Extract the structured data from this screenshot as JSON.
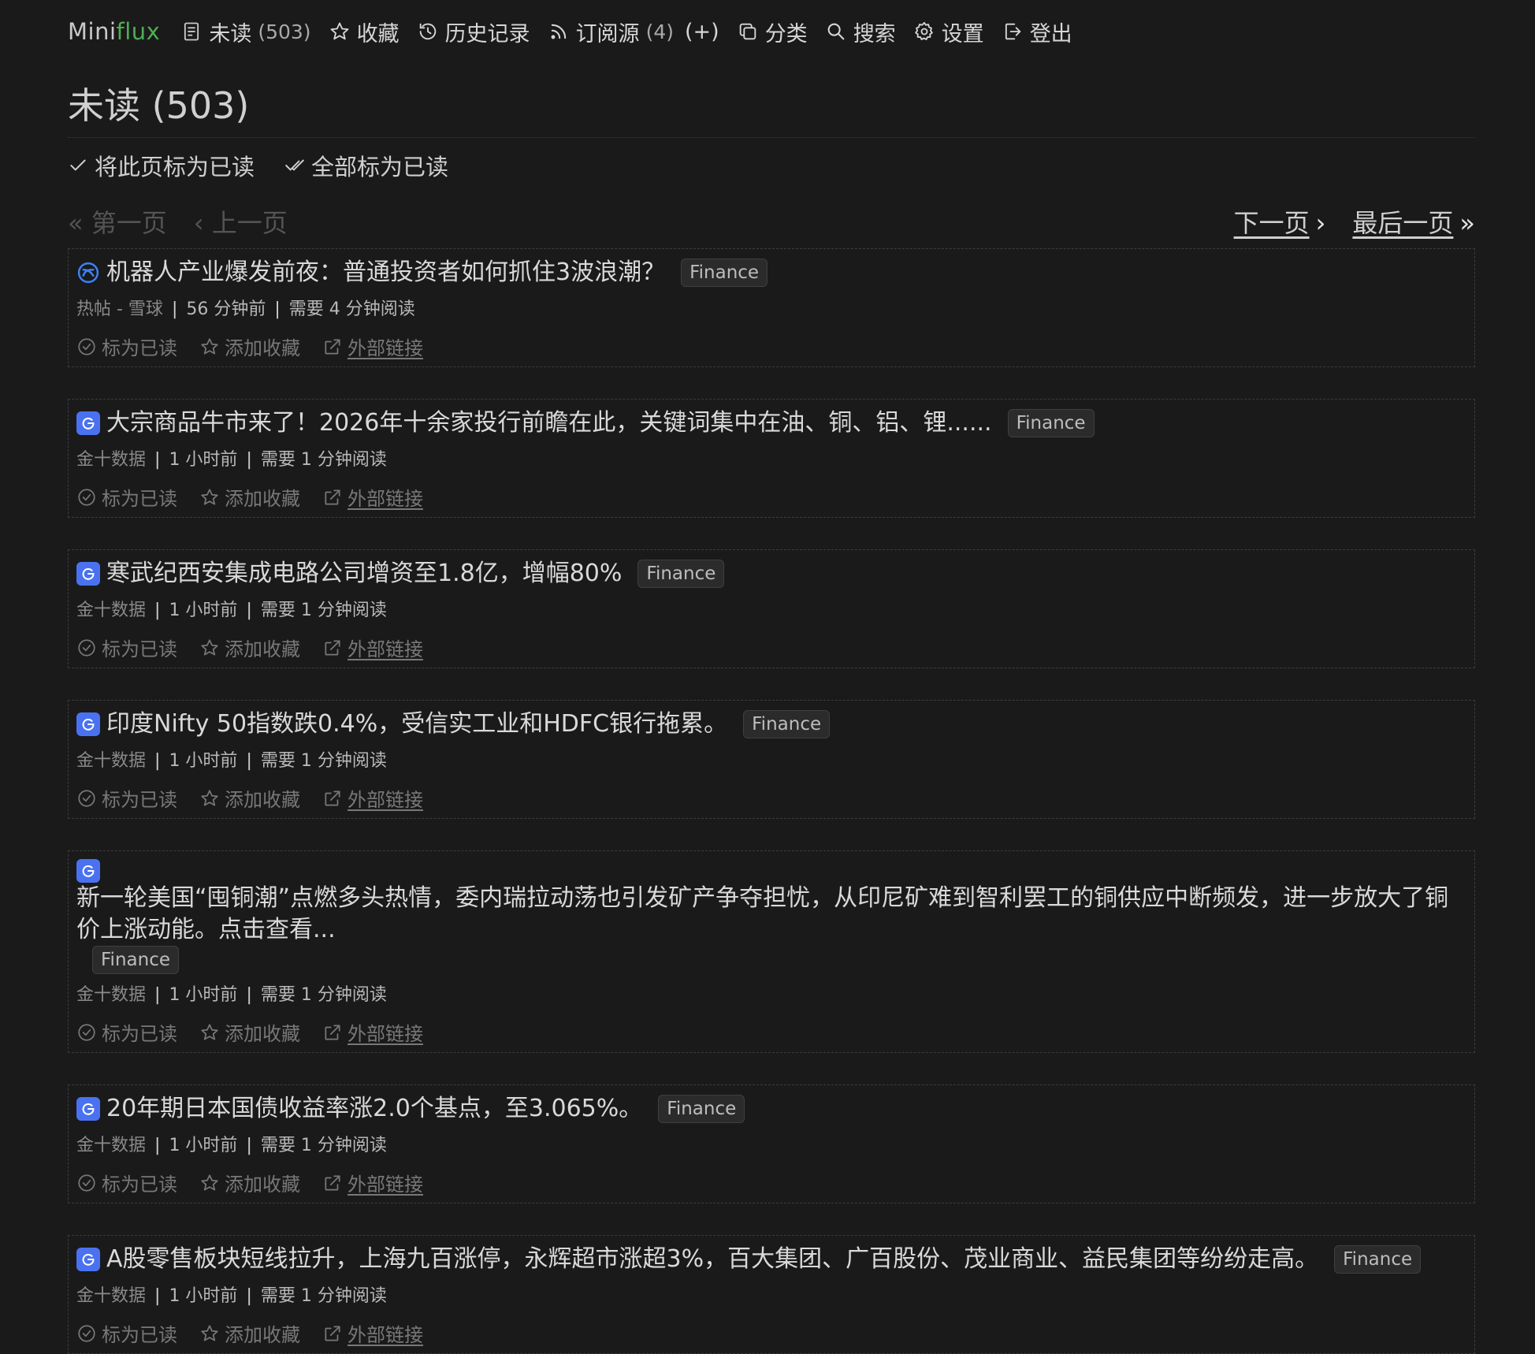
{
  "header": {
    "logo_part1": "Mini",
    "logo_part2": "flux",
    "nav": {
      "unread_label": "未读",
      "unread_count": "(503)",
      "starred_label": "收藏",
      "history_label": "历史记录",
      "feeds_label": "订阅源",
      "feeds_count": "(4)",
      "feeds_add": "(+)",
      "categories_label": "分类",
      "search_label": "搜索",
      "settings_label": "设置",
      "logout_label": "登出"
    }
  },
  "page": {
    "title": "未读 (503)",
    "mark_page_read": "将此页标为已读",
    "mark_all_read": "全部标为已读"
  },
  "pagination": {
    "first": "« 第一页",
    "prev": "‹ 上一页",
    "next": "下一页",
    "next_arrow": "›",
    "last": "最后一页",
    "last_arrow": "»"
  },
  "entry_actions": {
    "mark_read": "标为已读",
    "star": "添加收藏",
    "external": "外部链接"
  },
  "entries": [
    {
      "title": "机器人产业爆发前夜：普通投资者如何抓住3波浪潮？",
      "tag": "Finance",
      "feed": "热帖 - 雪球",
      "time": "56 分钟前",
      "read_time": "需要 4 分钟阅读",
      "icon": "xueqiu-icon"
    },
    {
      "title": "大宗商品牛市来了！2026年十余家投行前瞻在此，关键词集中在油、铜、铝、锂......",
      "tag": "Finance",
      "feed": "金十数据",
      "time": "1 小时前",
      "read_time": "需要 1 分钟阅读",
      "icon": "jin10-icon"
    },
    {
      "title": "寒武纪西安集成电路公司增资至1.8亿，增幅80%",
      "tag": "Finance",
      "feed": "金十数据",
      "time": "1 小时前",
      "read_time": "需要 1 分钟阅读",
      "icon": "jin10-icon"
    },
    {
      "title": "印度Nifty 50指数跌0.4%，受信实工业和HDFC银行拖累。",
      "tag": "Finance",
      "feed": "金十数据",
      "time": "1 小时前",
      "read_time": "需要 1 分钟阅读",
      "icon": "jin10-icon"
    },
    {
      "title": "新一轮美国“囤铜潮”点燃多头热情，委内瑞拉动荡也引发矿产争夺担忧，从印尼矿难到智利罢工的铜供应中断频发，进一步放大了铜价上涨动能。点击查看...",
      "tag": "Finance",
      "feed": "金十数据",
      "time": "1 小时前",
      "read_time": "需要 1 分钟阅读",
      "icon": "jin10-icon"
    },
    {
      "title": "20年期日本国债收益率涨2.0个基点，至3.065%。",
      "tag": "Finance",
      "feed": "金十数据",
      "time": "1 小时前",
      "read_time": "需要 1 分钟阅读",
      "icon": "jin10-icon"
    },
    {
      "title": "A股零售板块短线拉升，上海九百涨停，永辉超市涨超3%，百大集团、广百股份、茂业商业、益民集团等纷纷走高。",
      "tag": "Finance",
      "feed": "金十数据",
      "time": "1 小时前",
      "read_time": "需要 1 分钟阅读",
      "icon": "jin10-icon"
    }
  ],
  "colors": {
    "background": "#1a1a1a",
    "accent_green": "#4caf50",
    "jin10_blue": "#4a72f0"
  }
}
